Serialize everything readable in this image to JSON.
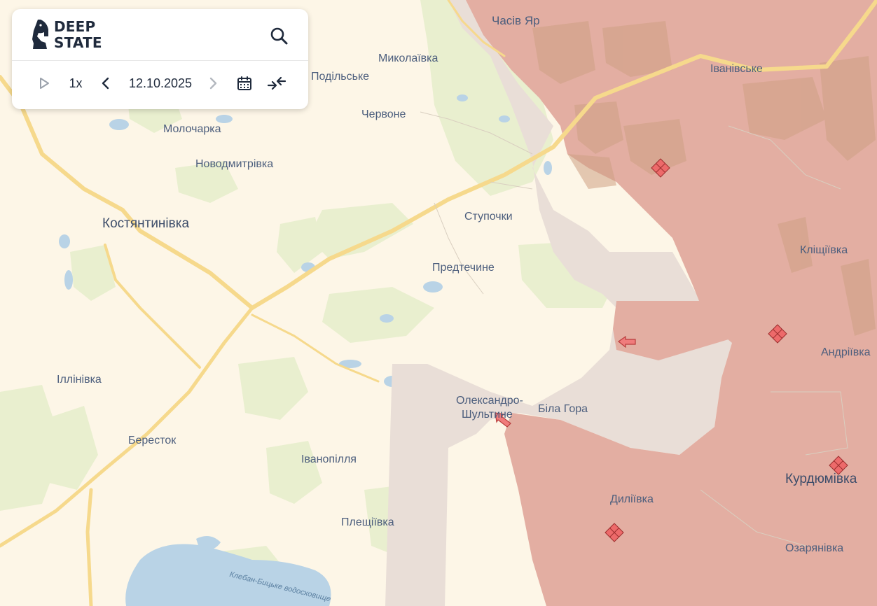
{
  "app": {
    "logo_line1": "DEEP",
    "logo_line2": "STATE"
  },
  "toolbar": {
    "speed": "1x",
    "date": "12.10.2025"
  },
  "icons": {
    "logo": "knight-chess-icon",
    "search": "search-icon",
    "play": "play-icon",
    "prev": "chevron-left-icon",
    "next": "chevron-right-icon",
    "calendar": "calendar-icon",
    "compare": "collapse-arrows-icon"
  },
  "colors": {
    "background": "#fdf6e7",
    "occupied": "#e3aea2",
    "contested": "#e9ded7",
    "fields": "#e9efcf",
    "roads": "#f6d98c",
    "water": "#b9d3e6",
    "markers": "#e65a5a"
  },
  "places": {
    "chasiv_yar": "Часів Яр",
    "mykolaivka": "Миколаївка",
    "podilske": "Подільське",
    "chervone": "Червоне",
    "ivanivske": "Іванівське",
    "molocharka": "Молочарка",
    "novodmytrivka": "Новодмитрівка",
    "kostiantynivka": "Костянтинівка",
    "stupochky": "Ступочки",
    "predtechyne": "Предтечине",
    "klishchiivka": "Кліщіївка",
    "andriivka": "Андріївка",
    "illinivka": "Іллінівка",
    "oleksandro_line1": "Олександро-",
    "oleksandro_line2": "Шультине",
    "bila_hora": "Біла Гора",
    "berestok": "Бересток",
    "ivanopillia": "Іванопілля",
    "dyliivka": "Диліївка",
    "kurdiumivka": "Курдюмівка",
    "pleshchiivka": "Плещіївка",
    "ozarianivka": "Озарянівка",
    "reservoir": "Клебан-Бицьке водосховище"
  }
}
